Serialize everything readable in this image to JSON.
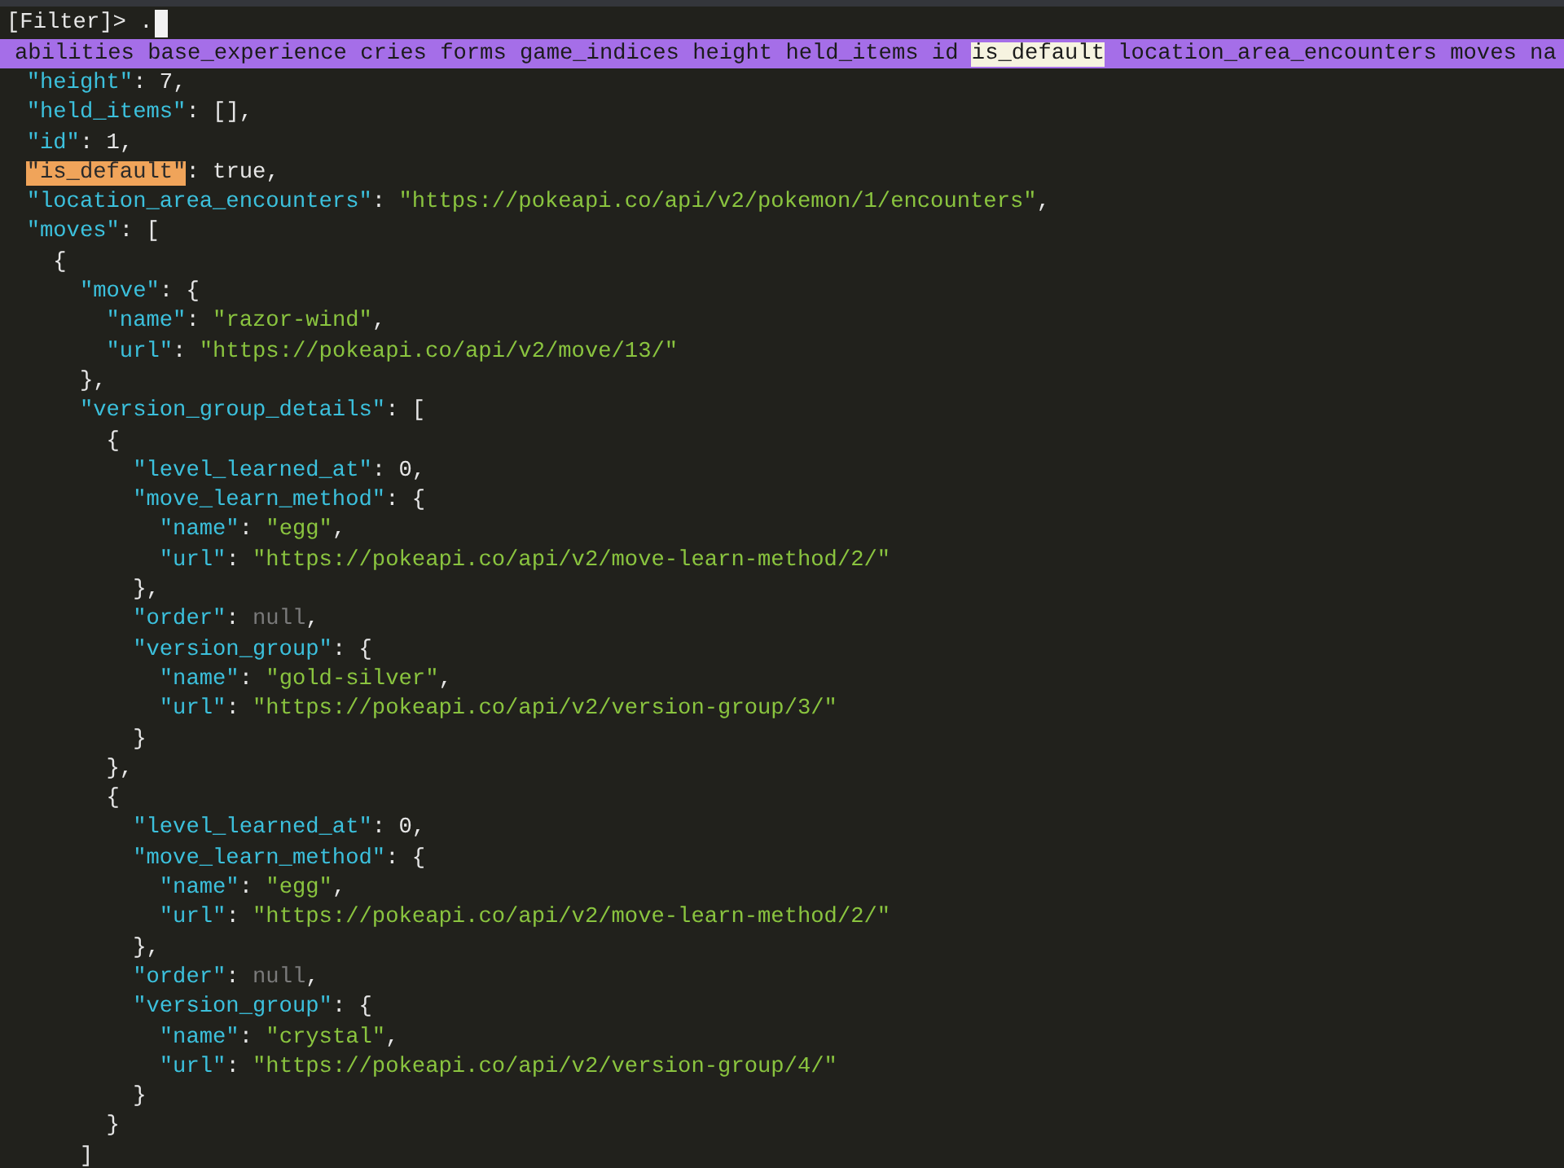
{
  "prompt": {
    "label": "[Filter]>",
    "query": "."
  },
  "completions": [
    {
      "label": "abilities",
      "selected": false
    },
    {
      "label": "base_experience",
      "selected": false
    },
    {
      "label": "cries",
      "selected": false
    },
    {
      "label": "forms",
      "selected": false
    },
    {
      "label": "game_indices",
      "selected": false
    },
    {
      "label": "height",
      "selected": false
    },
    {
      "label": "held_items",
      "selected": false
    },
    {
      "label": "id",
      "selected": false
    },
    {
      "label": "is_default",
      "selected": true
    },
    {
      "label": "location_area_encounters",
      "selected": false
    },
    {
      "label": "moves",
      "selected": false
    },
    {
      "label": "na",
      "selected": false
    }
  ],
  "lines": [
    {
      "tokens": [
        {
          "kind": "key",
          "text": "\"height\""
        },
        {
          "kind": "punct",
          "text": ": "
        },
        {
          "kind": "number",
          "text": "7"
        },
        {
          "kind": "punct",
          "text": ","
        }
      ]
    },
    {
      "tokens": [
        {
          "kind": "key",
          "text": "\"held_items\""
        },
        {
          "kind": "punct",
          "text": ": [],"
        }
      ]
    },
    {
      "tokens": [
        {
          "kind": "key",
          "text": "\"id\""
        },
        {
          "kind": "punct",
          "text": ": "
        },
        {
          "kind": "number",
          "text": "1"
        },
        {
          "kind": "punct",
          "text": ","
        }
      ]
    },
    {
      "tokens": [
        {
          "kind": "match",
          "text": "\"is_default\""
        },
        {
          "kind": "punct",
          "text": ": "
        },
        {
          "kind": "bool",
          "text": "true"
        },
        {
          "kind": "punct",
          "text": ","
        }
      ]
    },
    {
      "tokens": [
        {
          "kind": "key",
          "text": "\"location_area_encounters\""
        },
        {
          "kind": "punct",
          "text": ": "
        },
        {
          "kind": "string",
          "text": "\"https://pokeapi.co/api/v2/pokemon/1/encounters\""
        },
        {
          "kind": "punct",
          "text": ","
        }
      ]
    },
    {
      "tokens": [
        {
          "kind": "key",
          "text": "\"moves\""
        },
        {
          "kind": "punct",
          "text": ": ["
        }
      ],
      "children": [
        {
          "tokens": [
            {
              "kind": "punct",
              "text": "{"
            }
          ],
          "children": [
            {
              "tokens": [
                {
                  "kind": "key",
                  "text": "\"move\""
                },
                {
                  "kind": "punct",
                  "text": ": {"
                }
              ],
              "children": [
                {
                  "tokens": [
                    {
                      "kind": "key",
                      "text": "\"name\""
                    },
                    {
                      "kind": "punct",
                      "text": ": "
                    },
                    {
                      "kind": "string",
                      "text": "\"razor-wind\""
                    },
                    {
                      "kind": "punct",
                      "text": ","
                    }
                  ]
                },
                {
                  "tokens": [
                    {
                      "kind": "key",
                      "text": "\"url\""
                    },
                    {
                      "kind": "punct",
                      "text": ": "
                    },
                    {
                      "kind": "string",
                      "text": "\"https://pokeapi.co/api/v2/move/13/\""
                    }
                  ]
                }
              ]
            },
            {
              "tokens": [
                {
                  "kind": "punct",
                  "text": "},"
                }
              ]
            },
            {
              "tokens": [
                {
                  "kind": "key",
                  "text": "\"version_group_details\""
                },
                {
                  "kind": "punct",
                  "text": ": ["
                }
              ],
              "children": [
                {
                  "tokens": [
                    {
                      "kind": "punct",
                      "text": "{"
                    }
                  ],
                  "children": [
                    {
                      "tokens": [
                        {
                          "kind": "key",
                          "text": "\"level_learned_at\""
                        },
                        {
                          "kind": "punct",
                          "text": ": "
                        },
                        {
                          "kind": "number",
                          "text": "0"
                        },
                        {
                          "kind": "punct",
                          "text": ","
                        }
                      ]
                    },
                    {
                      "tokens": [
                        {
                          "kind": "key",
                          "text": "\"move_learn_method\""
                        },
                        {
                          "kind": "punct",
                          "text": ": {"
                        }
                      ],
                      "children": [
                        {
                          "tokens": [
                            {
                              "kind": "key",
                              "text": "\"name\""
                            },
                            {
                              "kind": "punct",
                              "text": ": "
                            },
                            {
                              "kind": "string",
                              "text": "\"egg\""
                            },
                            {
                              "kind": "punct",
                              "text": ","
                            }
                          ]
                        },
                        {
                          "tokens": [
                            {
                              "kind": "key",
                              "text": "\"url\""
                            },
                            {
                              "kind": "punct",
                              "text": ": "
                            },
                            {
                              "kind": "string",
                              "text": "\"https://pokeapi.co/api/v2/move-learn-method/2/\""
                            }
                          ]
                        }
                      ]
                    },
                    {
                      "tokens": [
                        {
                          "kind": "punct",
                          "text": "},"
                        }
                      ]
                    },
                    {
                      "tokens": [
                        {
                          "kind": "key",
                          "text": "\"order\""
                        },
                        {
                          "kind": "punct",
                          "text": ": "
                        },
                        {
                          "kind": "null",
                          "text": "null"
                        },
                        {
                          "kind": "punct",
                          "text": ","
                        }
                      ]
                    },
                    {
                      "tokens": [
                        {
                          "kind": "key",
                          "text": "\"version_group\""
                        },
                        {
                          "kind": "punct",
                          "text": ": {"
                        }
                      ],
                      "children": [
                        {
                          "tokens": [
                            {
                              "kind": "key",
                              "text": "\"name\""
                            },
                            {
                              "kind": "punct",
                              "text": ": "
                            },
                            {
                              "kind": "string",
                              "text": "\"gold-silver\""
                            },
                            {
                              "kind": "punct",
                              "text": ","
                            }
                          ]
                        },
                        {
                          "tokens": [
                            {
                              "kind": "key",
                              "text": "\"url\""
                            },
                            {
                              "kind": "punct",
                              "text": ": "
                            },
                            {
                              "kind": "string",
                              "text": "\"https://pokeapi.co/api/v2/version-group/3/\""
                            }
                          ]
                        }
                      ]
                    },
                    {
                      "tokens": [
                        {
                          "kind": "punct",
                          "text": "}"
                        }
                      ]
                    }
                  ]
                },
                {
                  "tokens": [
                    {
                      "kind": "punct",
                      "text": "},"
                    }
                  ]
                },
                {
                  "tokens": [
                    {
                      "kind": "punct",
                      "text": "{"
                    }
                  ],
                  "children": [
                    {
                      "tokens": [
                        {
                          "kind": "key",
                          "text": "\"level_learned_at\""
                        },
                        {
                          "kind": "punct",
                          "text": ": "
                        },
                        {
                          "kind": "number",
                          "text": "0"
                        },
                        {
                          "kind": "punct",
                          "text": ","
                        }
                      ]
                    },
                    {
                      "tokens": [
                        {
                          "kind": "key",
                          "text": "\"move_learn_method\""
                        },
                        {
                          "kind": "punct",
                          "text": ": {"
                        }
                      ],
                      "children": [
                        {
                          "tokens": [
                            {
                              "kind": "key",
                              "text": "\"name\""
                            },
                            {
                              "kind": "punct",
                              "text": ": "
                            },
                            {
                              "kind": "string",
                              "text": "\"egg\""
                            },
                            {
                              "kind": "punct",
                              "text": ","
                            }
                          ]
                        },
                        {
                          "tokens": [
                            {
                              "kind": "key",
                              "text": "\"url\""
                            },
                            {
                              "kind": "punct",
                              "text": ": "
                            },
                            {
                              "kind": "string",
                              "text": "\"https://pokeapi.co/api/v2/move-learn-method/2/\""
                            }
                          ]
                        }
                      ]
                    },
                    {
                      "tokens": [
                        {
                          "kind": "punct",
                          "text": "},"
                        }
                      ]
                    },
                    {
                      "tokens": [
                        {
                          "kind": "key",
                          "text": "\"order\""
                        },
                        {
                          "kind": "punct",
                          "text": ": "
                        },
                        {
                          "kind": "null",
                          "text": "null"
                        },
                        {
                          "kind": "punct",
                          "text": ","
                        }
                      ]
                    },
                    {
                      "tokens": [
                        {
                          "kind": "key",
                          "text": "\"version_group\""
                        },
                        {
                          "kind": "punct",
                          "text": ": {"
                        }
                      ],
                      "children": [
                        {
                          "tokens": [
                            {
                              "kind": "key",
                              "text": "\"name\""
                            },
                            {
                              "kind": "punct",
                              "text": ": "
                            },
                            {
                              "kind": "string",
                              "text": "\"crystal\""
                            },
                            {
                              "kind": "punct",
                              "text": ","
                            }
                          ]
                        },
                        {
                          "tokens": [
                            {
                              "kind": "key",
                              "text": "\"url\""
                            },
                            {
                              "kind": "punct",
                              "text": ": "
                            },
                            {
                              "kind": "string",
                              "text": "\"https://pokeapi.co/api/v2/version-group/4/\""
                            }
                          ]
                        }
                      ]
                    },
                    {
                      "tokens": [
                        {
                          "kind": "punct",
                          "text": "}"
                        }
                      ]
                    }
                  ]
                },
                {
                  "tokens": [
                    {
                      "kind": "punct",
                      "text": "}"
                    }
                  ]
                }
              ]
            },
            {
              "tokens": [
                {
                  "kind": "punct",
                  "text": "]"
                }
              ]
            }
          ]
        }
      ]
    }
  ]
}
